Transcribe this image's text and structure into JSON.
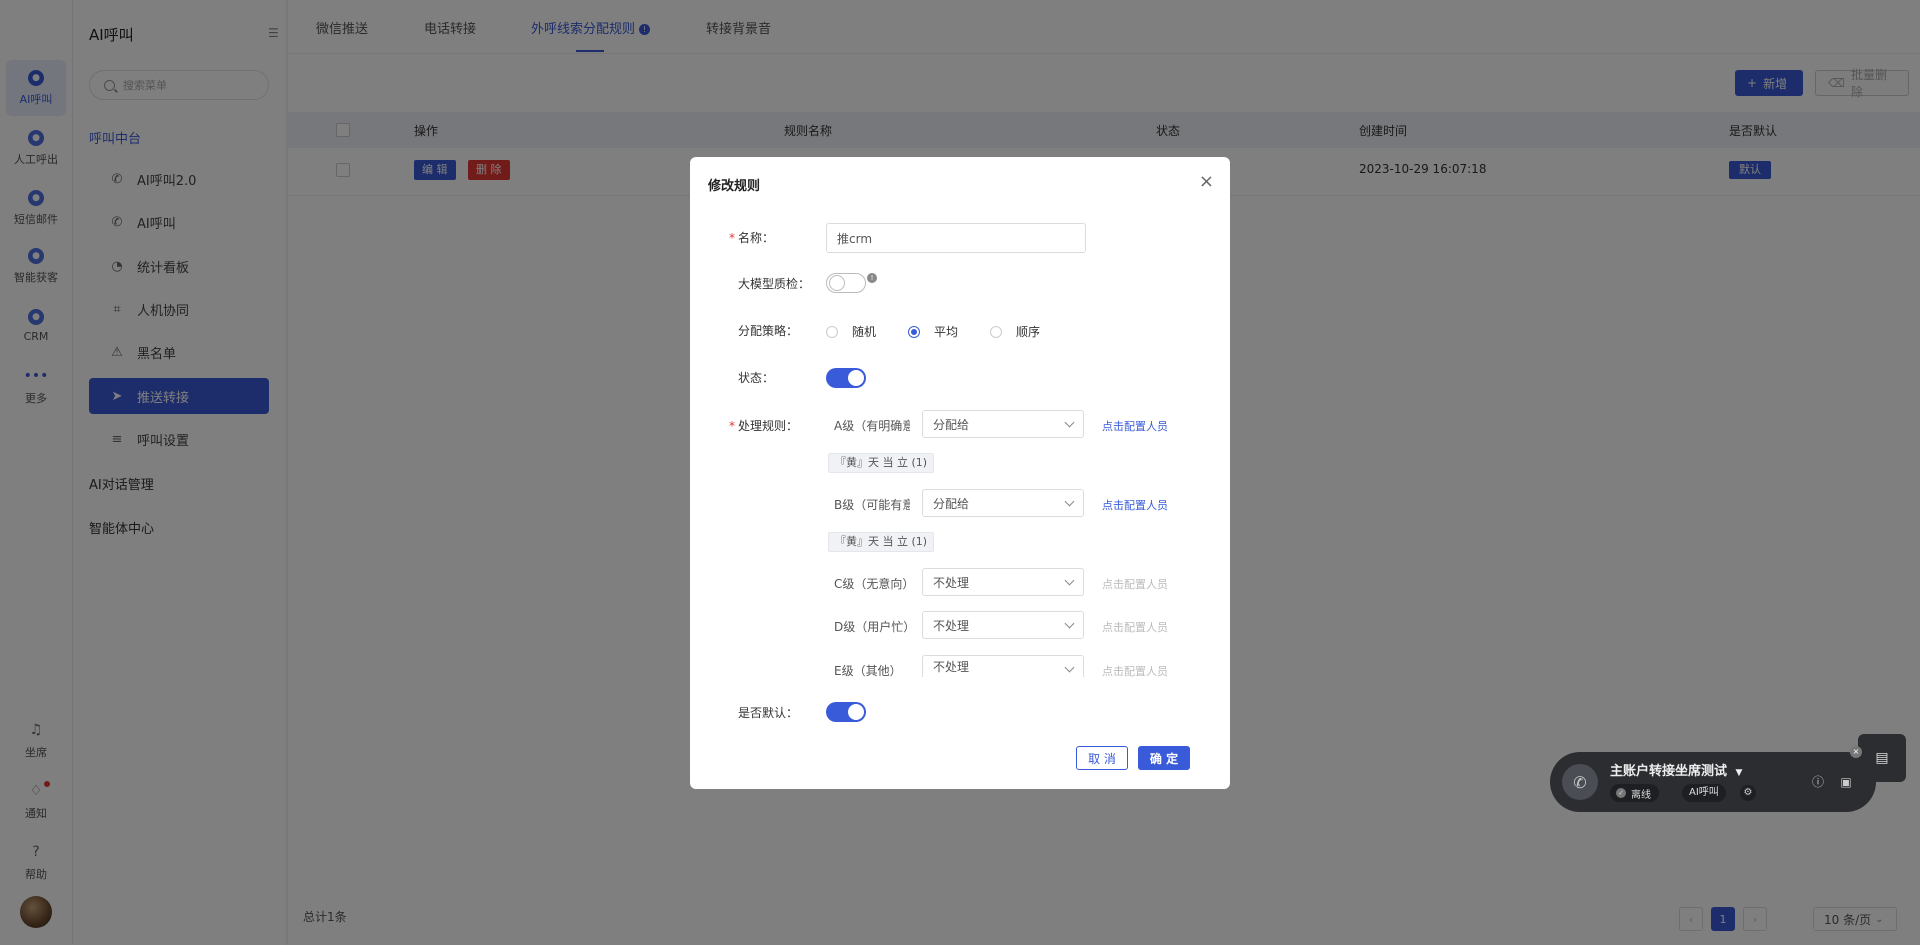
{
  "rail": {
    "items": [
      {
        "label": "AI呼叫"
      },
      {
        "label": "人工呼出"
      },
      {
        "label": "短信邮件"
      },
      {
        "label": "智能获客"
      },
      {
        "label": "CRM"
      },
      {
        "label": "更多"
      }
    ],
    "bottom": [
      {
        "label": "坐席"
      },
      {
        "label": "通知"
      },
      {
        "label": "帮助"
      }
    ]
  },
  "sidebar": {
    "title": "AI呼叫",
    "search_placeholder": "搜索菜单",
    "group_main": "呼叫中台",
    "items": [
      {
        "label": "AI呼叫2.0",
        "icon": "phone-icon"
      },
      {
        "label": "AI呼叫",
        "icon": "phone-icon"
      },
      {
        "label": "统计看板",
        "icon": "pie-chart-icon"
      },
      {
        "label": "人机协同",
        "icon": "scan-icon"
      },
      {
        "label": "黑名单",
        "icon": "warning-icon"
      },
      {
        "label": "推送转接",
        "icon": "send-icon"
      },
      {
        "label": "呼叫设置",
        "icon": "sliders-icon"
      }
    ],
    "group_dialog": "AI对话管理",
    "group_agent": "智能体中心"
  },
  "tabs": [
    {
      "label": "微信推送"
    },
    {
      "label": "电话转接"
    },
    {
      "label": "外呼线索分配规则",
      "badge": "!"
    },
    {
      "label": "转接背景音"
    }
  ],
  "toolbar": {
    "add_label": "新增",
    "batch_delete_label": "批量删除"
  },
  "table": {
    "headers": [
      "操作",
      "规则名称",
      "状态",
      "创建时间",
      "是否默认"
    ],
    "rows": [
      {
        "edit": "编 辑",
        "delete": "删 除",
        "created": "2023-10-29 16:07:18",
        "default": "默认"
      }
    ]
  },
  "footer": {
    "total": "总计1条",
    "page": "1",
    "page_size": "10 条/页"
  },
  "modal": {
    "title": "修改规则",
    "name_label": "名称：",
    "name_value": "推crm",
    "llm_qc_label": "大模型质检：",
    "strategy_label": "分配策略：",
    "strategy_options": [
      "随机",
      "平均",
      "顺序"
    ],
    "strategy_selected": "平均",
    "status_label": "状态：",
    "rules_label": "处理规则：",
    "rules": [
      {
        "level": "A级（有明确意向）",
        "action": "分配给",
        "link": "点击配置人员",
        "tag": "『黄』天 当 立 (1)"
      },
      {
        "level": "B级（可能有意向）",
        "action": "分配给",
        "link": "点击配置人员",
        "tag": "『黄』天 当 立 (1)"
      },
      {
        "level": "C级（无意向）",
        "action": "不处理",
        "link": "点击配置人员"
      },
      {
        "level": "D级（用户忙）",
        "action": "不处理",
        "link": "点击配置人员"
      },
      {
        "level": "E级（其他）",
        "action": "不处理",
        "link": "点击配置人员"
      }
    ],
    "default_label": "是否默认：",
    "cancel_label": "取 消",
    "ok_label": "确 定"
  },
  "phone_widget": {
    "name": "主账户转接坐席测试",
    "status": "离线",
    "mode": "AI呼叫"
  },
  "colors": {
    "accent": "#3a5bd9",
    "danger": "#e53935"
  }
}
